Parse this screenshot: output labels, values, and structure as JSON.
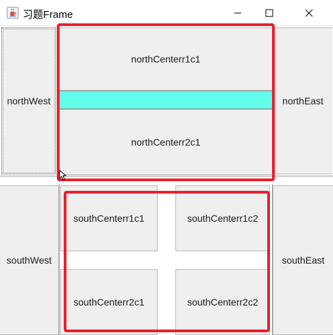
{
  "window": {
    "title": "习题Frame",
    "icon": "java-cup-icon",
    "controls": [
      "minimize-icon",
      "maximize-icon",
      "close-icon"
    ]
  },
  "north": {
    "west": "northWest",
    "center_row1": "northCenterr1c1",
    "center_row2": "northCenterr2c1",
    "east": "northEast"
  },
  "south": {
    "west": "southWest",
    "center": {
      "r1c1": "southCenterr1c1",
      "r1c2": "southCenterr1c2",
      "r2c1": "southCenterr2c1",
      "r2c2": "southCenterr2c2"
    },
    "east": "southEast"
  },
  "colors": {
    "highlight": "#e8212b",
    "cyan_bar": "#62fde9",
    "button_bg": "#efefef"
  }
}
